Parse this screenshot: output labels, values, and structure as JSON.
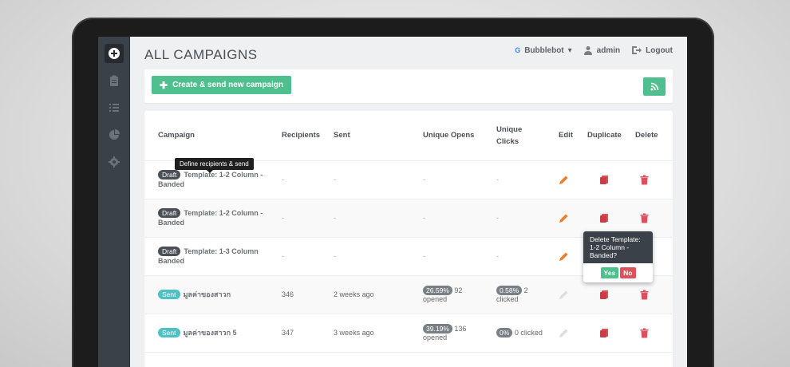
{
  "colors": {
    "accent": "#4fc08d",
    "danger": "#e0505a",
    "edit": "#f07d26",
    "sidebar": "#3b4148",
    "sent_badge": "#4fc1c4"
  },
  "header": {
    "title": "ALL CAMPAIGNS",
    "account": "Bubblebot",
    "user": "admin",
    "logout": "Logout"
  },
  "toolbar": {
    "create_label": "Create & send new campaign"
  },
  "table": {
    "columns": [
      "Campaign",
      "Recipients",
      "Sent",
      "Unique Opens",
      "Unique Clicks",
      "Edit",
      "Duplicate",
      "Delete"
    ],
    "rows": [
      {
        "status": "Draft",
        "name": "Template: 1-2 Column - Banded",
        "recipients": "-",
        "sent": "-",
        "opens": "-",
        "clicks": "-"
      },
      {
        "status": "Draft",
        "name": "Template: 1-2 Column - Banded",
        "recipients": "-",
        "sent": "-",
        "opens": "-",
        "clicks": "-"
      },
      {
        "status": "Draft",
        "name": "Template: 1-3 Column Banded",
        "recipients": "-",
        "sent": "-",
        "opens": "-",
        "clicks": "-"
      },
      {
        "status": "Sent",
        "name": "มูลค่าของสาวก",
        "recipients": "346",
        "sent": "2 weeks ago",
        "opens_pct": "26.59%",
        "opens_n": "92",
        "opens_label": "opened",
        "clicks_pct": "0.58%",
        "clicks_n": "2",
        "clicks_label": "clicked"
      },
      {
        "status": "Sent",
        "name": "มูลค่าของสาวก 5",
        "recipients": "347",
        "sent": "3 weeks ago",
        "opens_pct": "39.19%",
        "opens_n": "136",
        "opens_label": "opened",
        "clicks_pct": "0%",
        "clicks_label": "0 clicked"
      }
    ]
  },
  "tooltip": {
    "text": "Define recipients & send"
  },
  "popover": {
    "title": "Delete Template: 1-2 Column - Banded?",
    "yes": "Yes",
    "no": "No"
  },
  "icons": [
    "plus-icon",
    "clipboard-icon",
    "list-icon",
    "pie-chart-icon",
    "gear-icon",
    "user-icon",
    "logout-icon",
    "rss-icon",
    "pencil-icon",
    "copy-icon",
    "trash-icon"
  ]
}
